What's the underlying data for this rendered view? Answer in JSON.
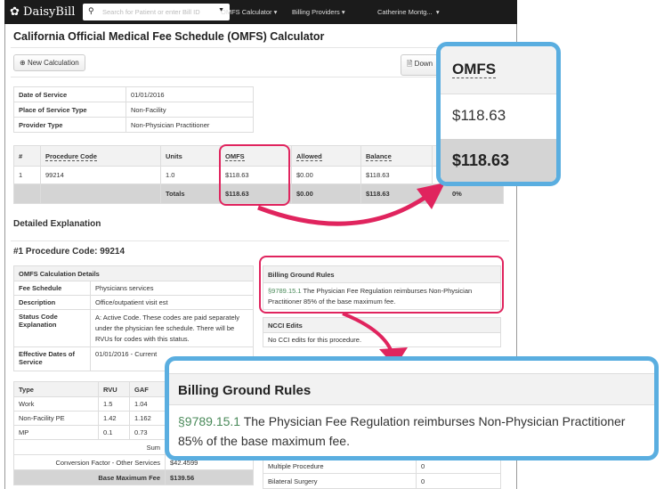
{
  "nav": {
    "logo": "DaisyBill",
    "search_placeholder": "Search for Patient or enter Bill ID",
    "menu1": "OMFS Calculator",
    "menu2": "Billing Providers",
    "user": "Catherine Montg..."
  },
  "page": {
    "title": "California Official Medical Fee Schedule (OMFS) Calculator",
    "new_calc": "New Calculation",
    "download": "Down"
  },
  "info": [
    [
      "Date of Service",
      "01/01/2016"
    ],
    [
      "Place of Service Type",
      "Non-Facility"
    ],
    [
      "Provider Type",
      "Non-Physician Practitioner"
    ]
  ],
  "proc_table": {
    "headers": [
      "#",
      "Procedure Code",
      "Units",
      "OMFS",
      "Allowed",
      "Balance"
    ],
    "row": [
      "1",
      "99214",
      "1.0",
      "$118.63",
      "$0.00",
      "$118.63"
    ],
    "totals": {
      "label": "Totals",
      "omfs": "$118.63",
      "allowed": "$0.00",
      "balance": "$118.63",
      "extra": "0%"
    }
  },
  "detail": {
    "heading": "Detailed Explanation",
    "proc_heading": "#1 Procedure Code: 99214",
    "calc_title": "OMFS Calculation Details",
    "rows": [
      [
        "Fee Schedule",
        "Physicians services"
      ],
      [
        "Description",
        "Office/outpatient visit est"
      ],
      [
        "Status Code Explanation",
        "A: Active Code. These codes are paid separately under the physician fee schedule. There will be RVUs for codes with this status."
      ],
      [
        "Effective Dates of Service",
        "01/01/2016 - Current"
      ]
    ]
  },
  "rvu": {
    "headers": [
      "Type",
      "RVU",
      "GAF"
    ],
    "rows": [
      [
        "Work",
        "1.5",
        "1.04"
      ],
      [
        "Non-Facility PE",
        "1.42",
        "1.162"
      ],
      [
        "MP",
        "0.1",
        "0.73"
      ]
    ],
    "sum": "Sum",
    "cf_label": "Conversion Factor - Other Services",
    "cf_value": "$42.4599",
    "base_label": "Base Maximum Fee",
    "base_value": "$139.56"
  },
  "rules": {
    "title": "Billing Ground Rules",
    "ref": "§9789.15.1",
    "text": " The Physician Fee Regulation reimburses Non-Physician Practitioner 85% of the base maximum fee."
  },
  "ncci": {
    "title": "NCCI Edits",
    "text": "No CCI edits for this procedure."
  },
  "modifiers": [
    [
      "Multiple Procedure",
      "0"
    ],
    [
      "Bilateral Surgery",
      "0"
    ]
  ],
  "callout_omfs": {
    "header": "OMFS",
    "value": "$118.63",
    "total": "$118.63"
  },
  "colors": {
    "highlight": "#e0245e",
    "callout": "#5aaee0"
  }
}
